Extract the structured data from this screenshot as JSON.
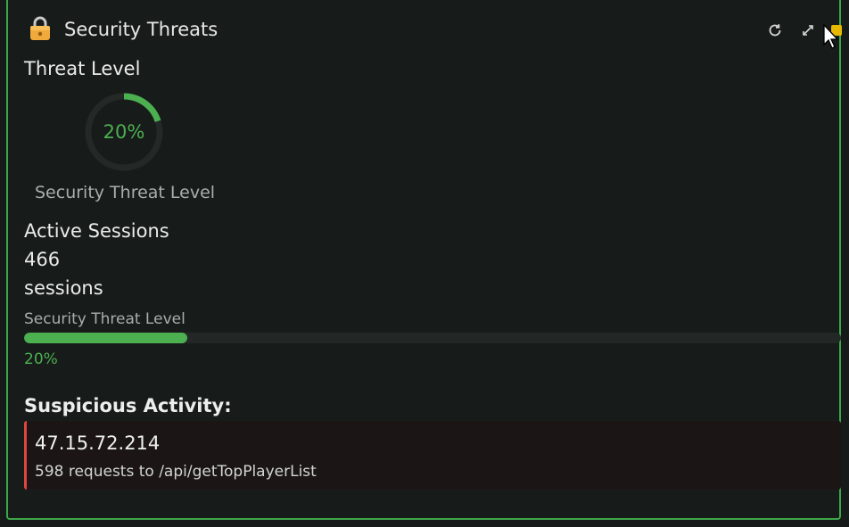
{
  "header": {
    "title": "Security Threats",
    "icons": {
      "lock": "lock-icon",
      "refresh": "refresh-icon",
      "expand": "expand-icon",
      "close": "close-icon"
    }
  },
  "threat_level": {
    "heading": "Threat Level",
    "gauge_value": 0.2,
    "gauge_text": "20%",
    "caption": "Security Threat Level"
  },
  "sessions": {
    "heading": "Active Sessions",
    "count": "466",
    "unit": "sessions"
  },
  "threat_bar": {
    "label": "Security Threat Level",
    "value": 0.2,
    "percent_text": "20%"
  },
  "suspicious": {
    "heading": "Suspicious Activity:",
    "items": [
      {
        "ip": "47.15.72.214",
        "detail": "598 requests to /api/getTopPlayerList"
      }
    ]
  },
  "colors": {
    "accent": "#4caf50",
    "panel_border": "#3ea64a",
    "alert": "#e0463e",
    "lock": "#f0a93b",
    "close": "#e6b800"
  }
}
